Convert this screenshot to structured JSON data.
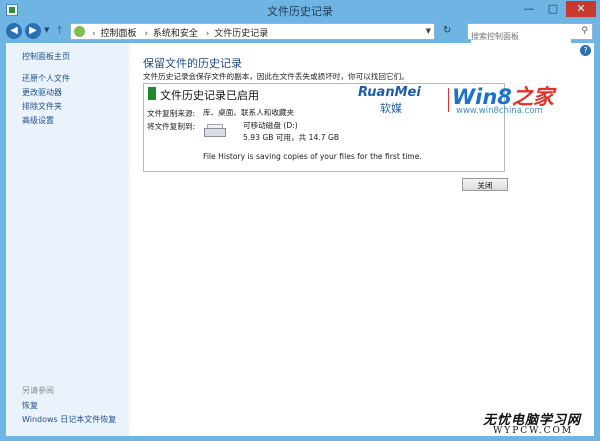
{
  "window": {
    "title": "文件历史记录",
    "minimize": "—",
    "maximize": "□",
    "close": "✕"
  },
  "address": {
    "crumbs": [
      "控制面板",
      "系统和安全",
      "文件历史记录"
    ],
    "search_placeholder": "搜索控制面板"
  },
  "sidebar": {
    "top_links": [
      "控制面板主页",
      "还原个人文件",
      "更改驱动器",
      "排除文件夹",
      "高级设置"
    ],
    "see_also_heading": "另请参阅",
    "bottom_links": [
      "恢复",
      "Windows 日记本文件恢复"
    ]
  },
  "main": {
    "heading": "保留文件的历史记录",
    "description": "文件历史记录会保存文件的副本，因此在文件丢失或损坏时，你可以找回它们。",
    "status": "文件历史记录已启用",
    "copy_from_label": "文件复制来源:",
    "copy_to_label": "将文件复制到:",
    "copy_from_value": "库、桌面、联系人和收藏夹",
    "drive_name": "可移动磁盘 (D:)",
    "drive_space": "5.93 GB 可用，共 14.7 GB",
    "history_message": "File History is saving copies of your files for the first time.",
    "close_button": "关闭"
  },
  "logo": {
    "brand": "RuanMei",
    "brand_cn": "软媒",
    "win_text": "Win8",
    "win_suffix": "之家",
    "url": "www.win8china.com"
  },
  "watermark": {
    "text": "无忧电脑学习网",
    "url": "WYPCW.COM"
  }
}
